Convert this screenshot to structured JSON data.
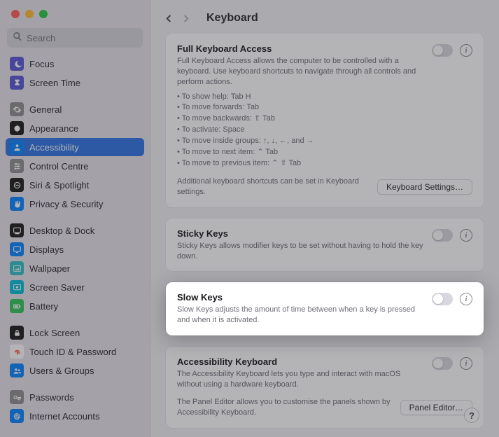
{
  "search": {
    "placeholder": "Search"
  },
  "sidebar": {
    "items": [
      {
        "label": "Focus",
        "icon": "moon",
        "bg": "#5856d6"
      },
      {
        "label": "Screen Time",
        "icon": "hourglass",
        "bg": "#5856d6"
      },
      {
        "label": "General",
        "icon": "gear",
        "bg": "#8e8e93"
      },
      {
        "label": "Appearance",
        "icon": "appearance",
        "bg": "#1c1c1e"
      },
      {
        "label": "Accessibility",
        "icon": "person",
        "bg": "#0a84ff",
        "selected": true
      },
      {
        "label": "Control Centre",
        "icon": "sliders",
        "bg": "#8e8e93"
      },
      {
        "label": "Siri & Spotlight",
        "icon": "siri",
        "bg": "#1c1c1e"
      },
      {
        "label": "Privacy & Security",
        "icon": "hand",
        "bg": "#0a84ff"
      },
      {
        "label": "Desktop & Dock",
        "icon": "dock",
        "bg": "#1c1c1e"
      },
      {
        "label": "Displays",
        "icon": "display",
        "bg": "#0a84ff"
      },
      {
        "label": "Wallpaper",
        "icon": "wallpaper",
        "bg": "#34c1c7"
      },
      {
        "label": "Screen Saver",
        "icon": "screensaver",
        "bg": "#09bdd9"
      },
      {
        "label": "Battery",
        "icon": "battery",
        "bg": "#34c759"
      },
      {
        "label": "Lock Screen",
        "icon": "lock",
        "bg": "#1c1c1e"
      },
      {
        "label": "Touch ID & Password",
        "icon": "fingerprint",
        "bg": "#ffffff"
      },
      {
        "label": "Users & Groups",
        "icon": "users",
        "bg": "#0a84ff"
      },
      {
        "label": "Passwords",
        "icon": "key",
        "bg": "#8e8e93"
      },
      {
        "label": "Internet Accounts",
        "icon": "at",
        "bg": "#0a84ff"
      }
    ]
  },
  "header": {
    "title": "Keyboard"
  },
  "cards": {
    "fka": {
      "title": "Full Keyboard Access",
      "desc": "Full Keyboard Access allows the computer to be controlled with a keyboard. Use keyboard shortcuts to navigate through all controls and perform actions.",
      "bullets": [
        "• To show help: Tab H",
        "• To move forwards: Tab",
        "• To move backwards: ⇧ Tab",
        "• To activate: Space",
        "• To move inside groups: ↑, ↓, ←, and →",
        "• To move to next item: ⌃ Tab",
        "• To move to previous item: ⌃ ⇧ Tab"
      ],
      "note": "Additional keyboard shortcuts can be set in Keyboard settings.",
      "button": "Keyboard Settings…"
    },
    "sticky": {
      "title": "Sticky Keys",
      "desc": "Sticky Keys allows modifier keys to be set without having to hold the key down."
    },
    "slow": {
      "title": "Slow Keys",
      "desc": "Slow Keys adjusts the amount of time between when a key is pressed and when it is activated."
    },
    "akbd": {
      "title": "Accessibility Keyboard",
      "desc": "The Accessibility Keyboard lets you type and interact with macOS without using a hardware keyboard.",
      "note": "The Panel Editor allows you to customise the panels shown by Accessibility Keyboard.",
      "button": "Panel Editor…"
    }
  },
  "help": "?"
}
